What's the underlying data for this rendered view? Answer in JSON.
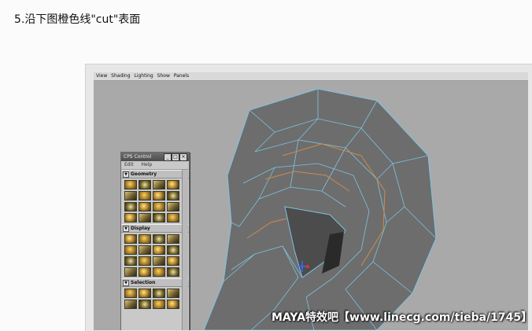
{
  "step_title": "5.沿下图橙色线\"cut\"表面",
  "menubar": [
    "View",
    "Shading",
    "Lighting",
    "Show",
    "Panels"
  ],
  "cps_panel": {
    "title": "CPS Control",
    "menu": [
      "Edit",
      "Help"
    ],
    "sections": [
      {
        "label": "Geometry",
        "icon_rows": 4
      },
      {
        "label": "Display",
        "icon_rows": 4
      },
      {
        "label": "Selection",
        "icon_rows": 2
      }
    ]
  },
  "watermark": "MAYA特效吧【www.linecg.com/tieba/1745】",
  "colors": {
    "wire": "#7ec3e0",
    "cut_line": "#d48a4a",
    "mesh": "#6b6b6b",
    "background": "#a9a9a9"
  }
}
